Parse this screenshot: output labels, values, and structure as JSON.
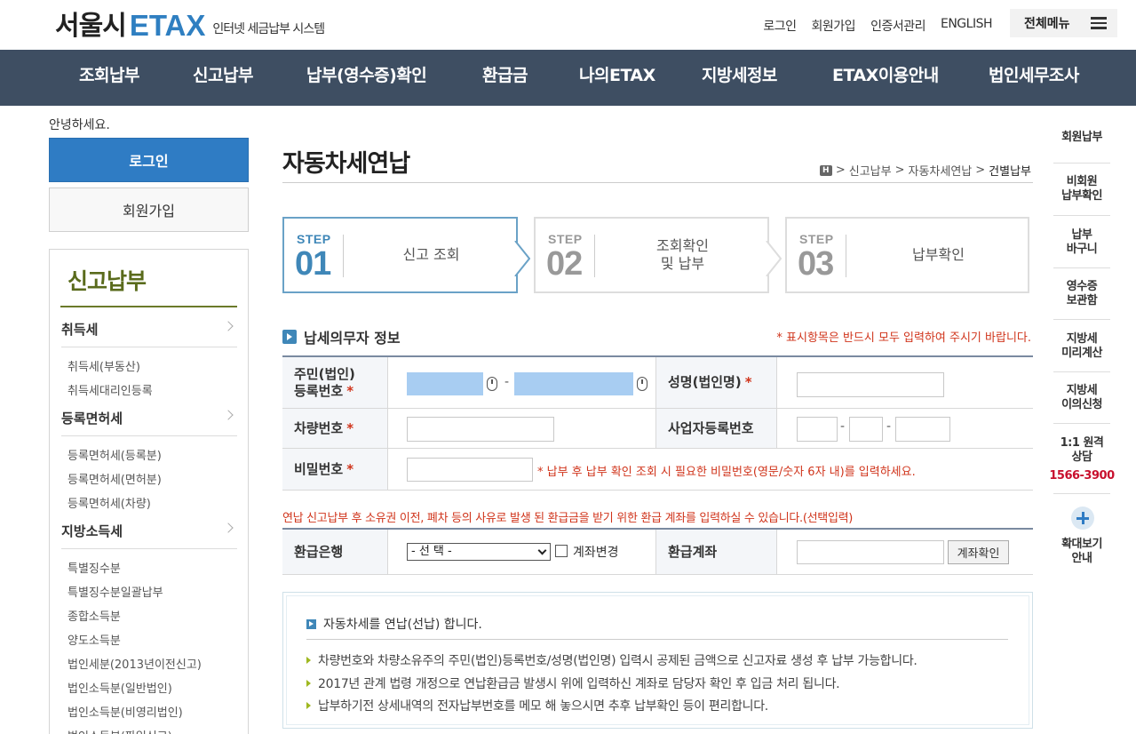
{
  "header": {
    "logo_kor": "서울시",
    "logo_etax": "ETAX",
    "logo_sub": "인터넷 세금납부 시스템",
    "links": [
      "로그인",
      "회원가입",
      "인증서관리",
      "ENGLISH"
    ],
    "all_menu": "전체메뉴"
  },
  "gnb": [
    "조회납부",
    "신고납부",
    "납부(영수증)확인",
    "환급금",
    "나의ETAX",
    "지방세정보",
    "ETAX이용안내",
    "법인세무조사"
  ],
  "left": {
    "greeting": "안녕하세요.",
    "login": "로그인",
    "join": "회원가입",
    "lnb_title": "신고납부",
    "cat1": "취득세",
    "cat1_subs": [
      "취득세(부동산)",
      "취득세대리인등록"
    ],
    "cat2": "등록면허세",
    "cat2_subs": [
      "등록면허세(등록분)",
      "등록면허세(면허분)",
      "등록면허세(차량)"
    ],
    "cat3": "지방소득세",
    "cat3_subs": [
      "특별징수분",
      "특별징수분일괄납부",
      "종합소득분",
      "양도소득분",
      "법인세분(2013년이전신고)",
      "법인소득분(일반법인)",
      "법인소득분(비영리법인)",
      "법인소득분(파일신고)"
    ]
  },
  "main": {
    "title": "자동차세연납",
    "breadcrumb": [
      "H",
      "신고납부",
      "자동차세연납",
      "건별납부"
    ],
    "steps": [
      {
        "label": "STEP",
        "num": "01",
        "text": "신고 조회"
      },
      {
        "label": "STEP",
        "num": "02",
        "text": "조회확인\n및 납부"
      },
      {
        "label": "STEP",
        "num": "03",
        "text": "납부확인"
      }
    ],
    "section_title": "납세의무자 정보",
    "required_note": "* 표시항목은 반드시 모두 입력하여 주시기 바랍니다.",
    "fields": {
      "resident_no": "주민(법인)\n등록번호",
      "name": "성명(법인명)",
      "car_no": "차량번호",
      "biz_no": "사업자등록번호",
      "password": "비밀번호",
      "password_hint": "* 납부 후 납부 확인 조회 시 필요한 비밀번호(영문/숫자 6자 내)를 입력하세요.",
      "star": "*"
    },
    "refund_note": "연납 신고납부 후 소유권 이전, 폐차 등의 사유로 발생 된 환급금을 받기 위한 환급 계좌를 입력하실 수 있습니다.(선택입력)",
    "refund_bank": "환급은행",
    "select_value": "- 선 택 -",
    "account_change": "계좌변경",
    "refund_account": "환급계좌",
    "account_check": "계좌확인",
    "info_title": "자동차세를 연납(선납) 합니다.",
    "info_items": [
      "차량번호와 차량소유주의 주민(법인)등록번호/성명(법인명) 입력시 공제된 금액으로 신고자료 생성 후 납부 가능합니다.",
      "2017년 관계 법령 개정으로 연납환급금 발생시 위에 입력하신 계좌로 담당자 확인 후 입금 처리 됩니다.",
      "납부하기전 상세내역의 전자납부번호를 메모 해 놓으시면 추후 납부확인 등이 편리합니다."
    ]
  },
  "quick": {
    "items": [
      "회원납부",
      "비회원\n납부확인",
      "납부\n바구니",
      "영수증\n보관함",
      "지방세\n미리계산",
      "지방세\n이의신청",
      "1:1 원격\n상담"
    ],
    "phone": "1566-3900",
    "zoom": "확대보기\n안내"
  },
  "colors": {
    "nav_bg": "#3e4e62",
    "accent": "#2f7cc4",
    "required": "#d0341b"
  }
}
